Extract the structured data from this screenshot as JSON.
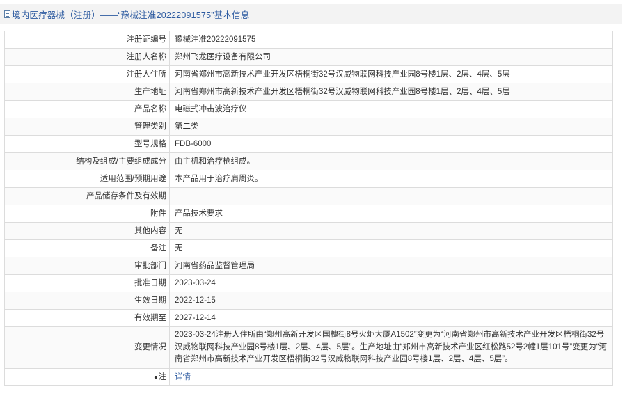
{
  "header": {
    "icon": "document-icon",
    "title": "境内医疗器械（注册）——“豫械注准20222091575”基本信息"
  },
  "rows": [
    {
      "key": "reg_no",
      "label": "注册证编号",
      "value": "豫械注准20222091575"
    },
    {
      "key": "registrant_name",
      "label": "注册人名称",
      "value": "郑州飞龙医疗设备有限公司"
    },
    {
      "key": "registrant_address",
      "label": "注册人住所",
      "value": "河南省郑州市高新技术产业开发区梧桐街32号汉威物联网科技产业园8号楼1层、2层、4层、5层"
    },
    {
      "key": "production_address",
      "label": "生产地址",
      "value": "河南省郑州市高新技术产业开发区梧桐街32号汉威物联网科技产业园8号楼1层、2层、4层、5层"
    },
    {
      "key": "product_name",
      "label": "产品名称",
      "value": "电磁式冲击波治疗仪"
    },
    {
      "key": "class",
      "label": "管理类别",
      "value": "第二类"
    },
    {
      "key": "model",
      "label": "型号规格",
      "value": "FDB-6000"
    },
    {
      "key": "structure",
      "label": "结构及组成/主要组成成分",
      "value": "由主机和治疗枪组成。"
    },
    {
      "key": "scope",
      "label": "适用范围/预期用途",
      "value": "本产品用于治疗肩周炎。"
    },
    {
      "key": "storage",
      "label": "产品储存条件及有效期",
      "value": ""
    },
    {
      "key": "attachment",
      "label": "附件",
      "value": "产品技术要求"
    },
    {
      "key": "other",
      "label": "其他内容",
      "value": "无"
    },
    {
      "key": "remark",
      "label": "备注",
      "value": "无"
    },
    {
      "key": "approval_dept",
      "label": "审批部门",
      "value": "河南省药品监督管理局"
    },
    {
      "key": "approval_date",
      "label": "批准日期",
      "value": "2023-03-24"
    },
    {
      "key": "effective_date",
      "label": "生效日期",
      "value": "2022-12-15"
    },
    {
      "key": "expiry_date",
      "label": "有效期至",
      "value": "2027-12-14"
    },
    {
      "key": "changes",
      "label": "变更情况",
      "value": "2023-03-24注册人住所由“郑州高新开发区国槐街8号火炬大厦A1502”变更为“河南省郑州市高新技术产业开发区梧桐街32号汉威物联网科技产业园8号楼1层、2层、4层、5层”。生产地址由“郑州市高新技术产业区红松路52号2幢1层101号”变更为“河南省郑州市高新技术产业开发区梧桐街32号汉威物联网科技产业园8号楼1层、2层、4层、5层”。"
    }
  ],
  "note_row": {
    "icon": "bullet-icon",
    "label": "注",
    "link": "详情"
  }
}
